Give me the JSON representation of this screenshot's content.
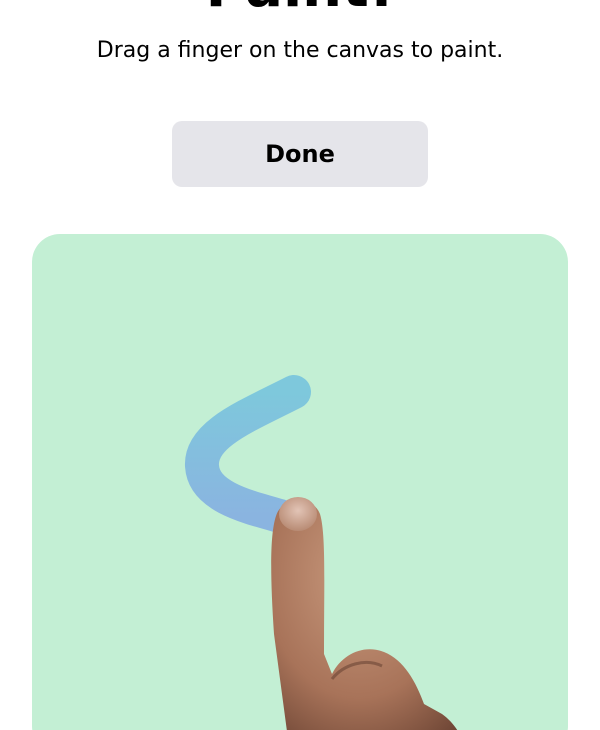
{
  "header": {
    "title": "Paint!",
    "instructions": "Drag a finger on the canvas to paint."
  },
  "toolbar": {
    "done_label": "Done"
  },
  "canvas": {
    "background_color": "#c3efd4",
    "stroke_color": "#7ec8dc",
    "stroke_color_end": "#8ab4e0"
  }
}
